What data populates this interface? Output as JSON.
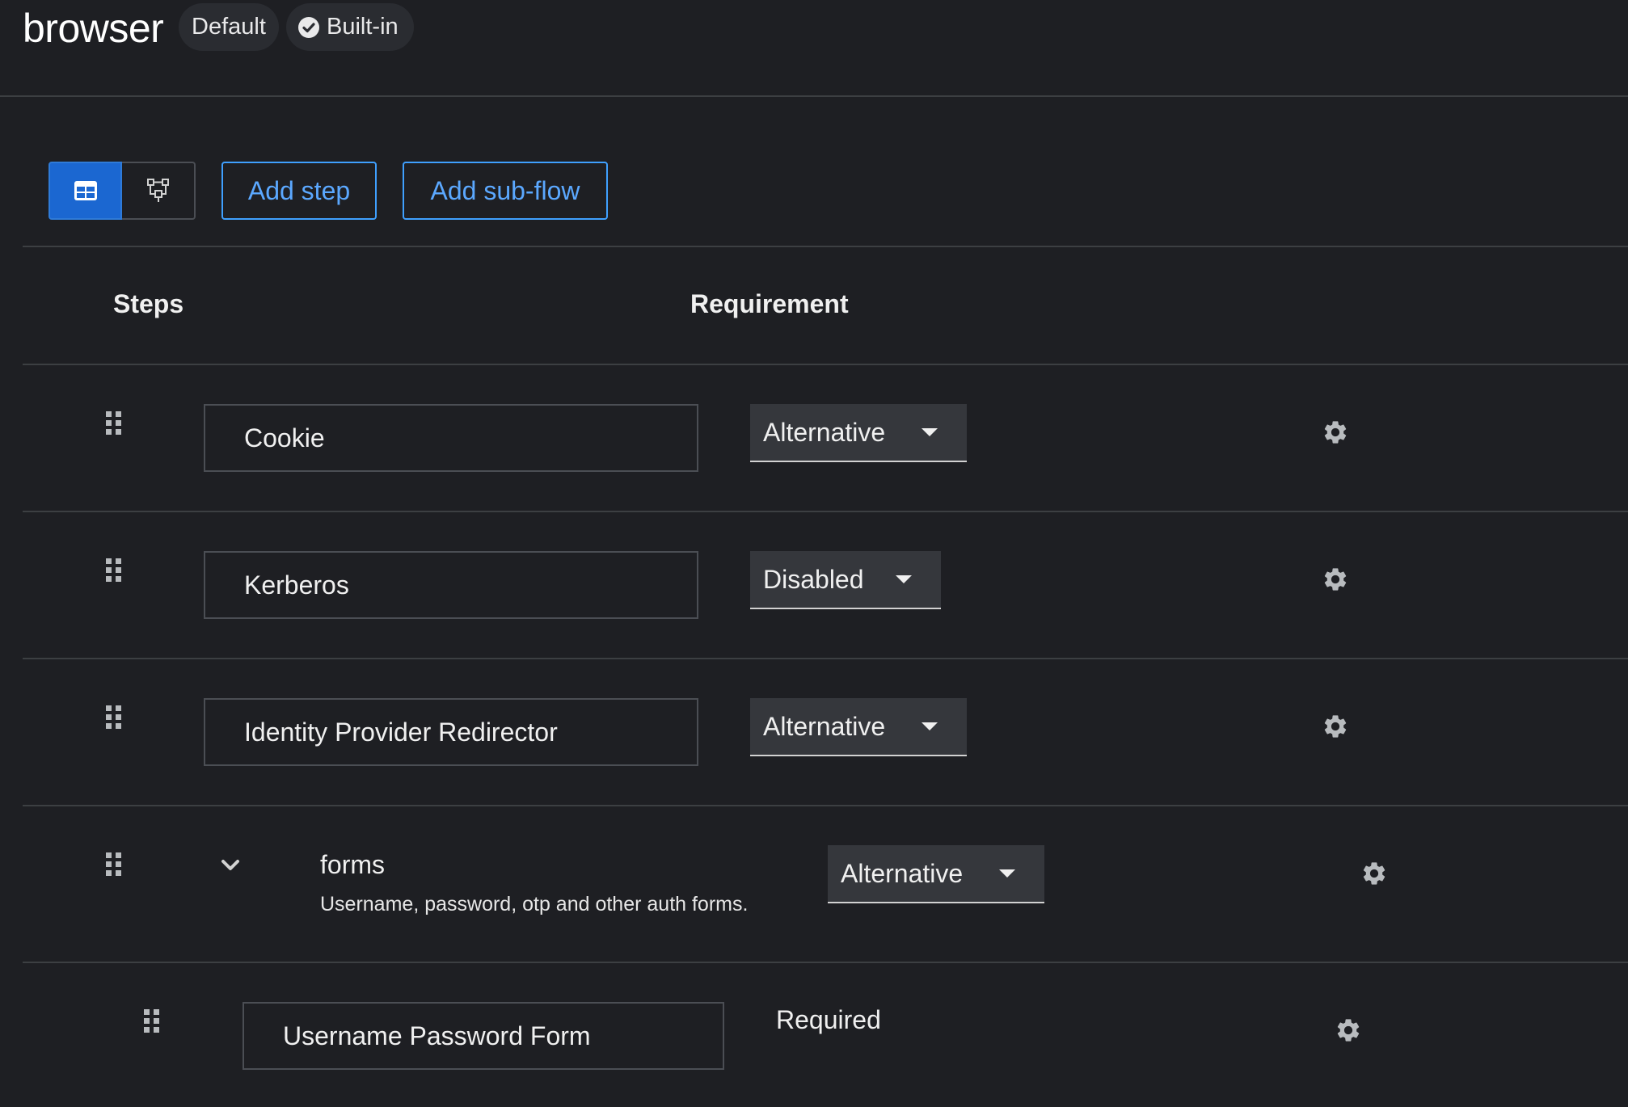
{
  "header": {
    "title": "browser",
    "labels": {
      "default": "Default",
      "builtin": "Built-in"
    }
  },
  "toolbar": {
    "view_toggle": {
      "table_icon": "table-icon",
      "diagram_icon": "flow-diagram-icon",
      "selected": "table"
    },
    "add_step": "Add step",
    "add_subflow": "Add sub-flow"
  },
  "table": {
    "headers": {
      "steps": "Steps",
      "requirement": "Requirement"
    },
    "rows": [
      {
        "name": "Cookie",
        "requirement": "Alternative",
        "type": "execution"
      },
      {
        "name": "Kerberos",
        "requirement": "Disabled",
        "type": "execution"
      },
      {
        "name": "Identity Provider Redirector",
        "requirement": "Alternative",
        "type": "execution"
      },
      {
        "name": "forms",
        "description": "Username, password, otp and other auth forms.",
        "requirement": "Alternative",
        "type": "subflow",
        "expanded": true
      },
      {
        "name": "Username Password Form",
        "requirement": "Required",
        "type": "execution",
        "nested": true
      }
    ]
  },
  "colors": {
    "background": "#1e1f23",
    "primary": "#1b67d1",
    "link": "#5ba8ff",
    "divider": "#3c3f42"
  }
}
